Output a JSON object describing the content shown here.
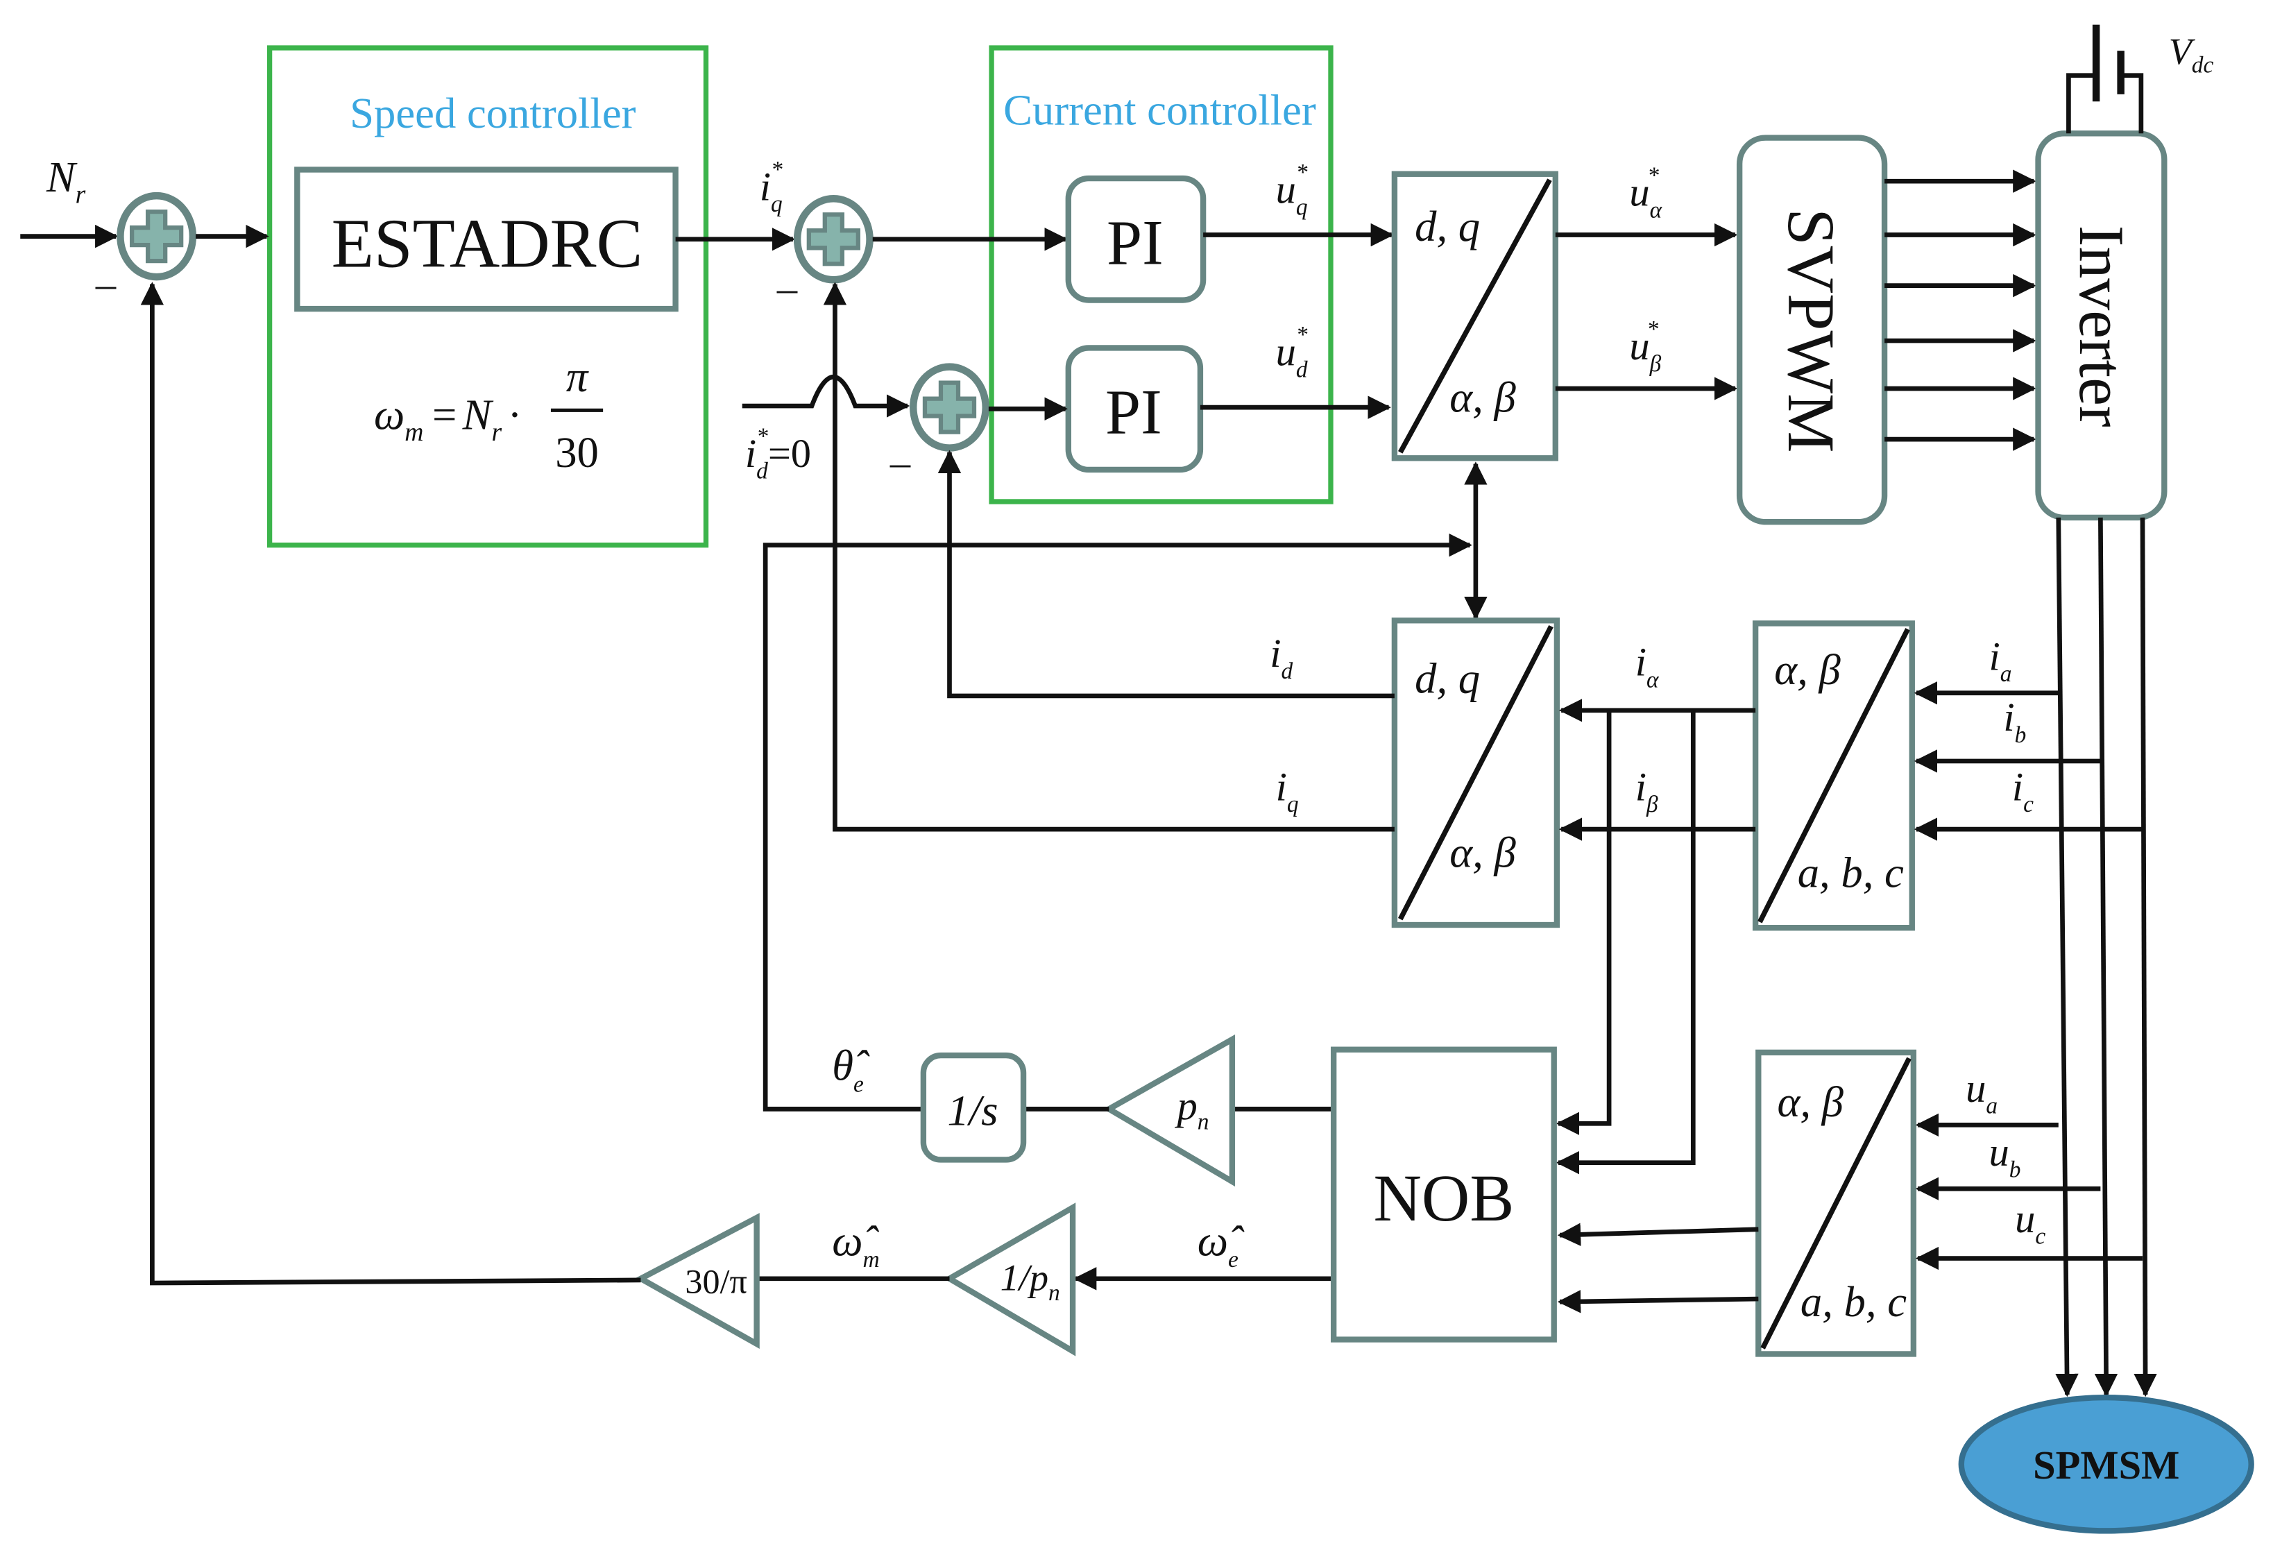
{
  "colors": {
    "block_border": "#678683",
    "controller_frame": "#3cb44b",
    "controller_title": "#3aa7e0",
    "motor_fill": "#4a9fd4",
    "sum_fill": "#86b3ab"
  },
  "icons": {
    "summing_junction": "plus-circle-icon",
    "dc_source": "battery-icon"
  },
  "speed_controller": {
    "title": "Speed controller",
    "block": "ESTADRC",
    "formula": {
      "lhs": "ω",
      "lhs_sub": "m",
      "eq": "=",
      "n": "N",
      "n_sub": "r",
      "dot": "·",
      "num": "π",
      "den": "30"
    }
  },
  "current_controller": {
    "title": "Current controller",
    "pi_q": "PI",
    "pi_d": "PI"
  },
  "signs": {
    "minus": "–"
  },
  "signals": {
    "nr": {
      "b": "N",
      "s": "r"
    },
    "iq_ref": {
      "b": "i",
      "s": "q",
      "p": "*"
    },
    "id_ref": {
      "b": "i",
      "s": "d",
      "p": "*",
      "tail": "=0"
    },
    "uq_ref": {
      "b": "u",
      "s": "q",
      "p": "*"
    },
    "ud_ref": {
      "b": "u",
      "s": "d",
      "p": "*"
    },
    "ualpha_ref": {
      "b": "u",
      "s": "α",
      "p": "*"
    },
    "ubeta_ref": {
      "b": "u",
      "s": "β",
      "p": "*"
    },
    "id": {
      "b": "i",
      "s": "d"
    },
    "iq": {
      "b": "i",
      "s": "q"
    },
    "ialpha": {
      "b": "i",
      "s": "α"
    },
    "ibeta": {
      "b": "i",
      "s": "β"
    },
    "ia": {
      "b": "i",
      "s": "a"
    },
    "ib": {
      "b": "i",
      "s": "b"
    },
    "ic": {
      "b": "i",
      "s": "c"
    },
    "ua": {
      "b": "u",
      "s": "a"
    },
    "ub": {
      "b": "u",
      "s": "b"
    },
    "uc": {
      "b": "u",
      "s": "c"
    },
    "theta_e": {
      "b": "θ̂",
      "s": "e"
    },
    "omega_e": {
      "b": "ω̂",
      "s": "e"
    },
    "omega_m": {
      "b": "ω̂",
      "s": "m"
    },
    "vdc": {
      "b": "V",
      "s": "dc"
    }
  },
  "blocks": {
    "park1": {
      "top": "d, q",
      "bottom": "α, β"
    },
    "park2": {
      "top": "d, q",
      "bottom": "α, β"
    },
    "clarke1": {
      "top": "α, β",
      "bottom": "a, b, c"
    },
    "clarke2": {
      "top": "α, β",
      "bottom": "a, b, c"
    },
    "svpwm": "SVPWM",
    "inverter": "Inverter",
    "nob": "NOB",
    "integrator": "1/s",
    "gain_pn": {
      "b": "p",
      "s": "n"
    },
    "gain_inv_pn": {
      "b": "1/p",
      "s": "n"
    },
    "gain_30pi": "30/π",
    "motor": "SPMSM"
  }
}
